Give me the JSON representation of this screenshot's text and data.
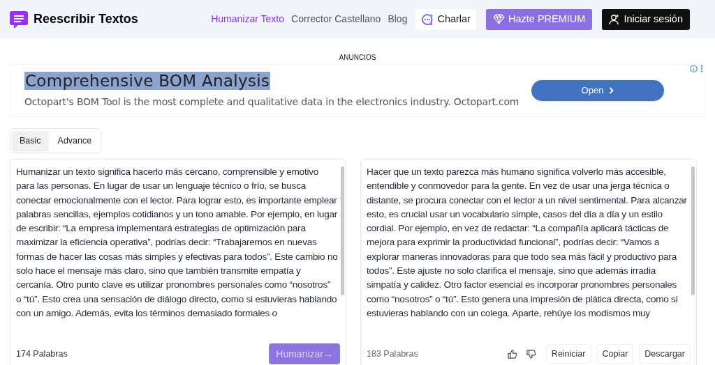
{
  "header": {
    "brand": "Reescribir Textos",
    "nav": [
      {
        "label": "Humanizar Texto",
        "selected": true
      },
      {
        "label": "Corrector Castellano",
        "selected": false
      },
      {
        "label": "Blog",
        "selected": false
      }
    ],
    "buttons": [
      {
        "kind": "chat",
        "label": "Charlar"
      },
      {
        "kind": "premium",
        "label": "Hazte PREMIUM"
      },
      {
        "kind": "login",
        "label": "Iniciar sesión"
      }
    ]
  },
  "ad": {
    "label": "ANUNCIOS",
    "title": "Comprehensive BOM Analysis",
    "description": "Octopart's BOM Tool is the most complete and qualitative data in the electronics industry. Octopart.com",
    "button": "Open"
  },
  "mode_tabs": [
    {
      "label": "Basic",
      "selected": true
    },
    {
      "label": "Advance",
      "selected": false
    }
  ],
  "input_panel": {
    "text": "Humanizar un texto significa hacerlo más cercano, comprensible y emotivo para las personas. En lugar de usar un lenguaje técnico o frío, se busca conectar emocionalmente con el lector. Para lograr esto, es importante emplear palabras sencillas, ejemplos cotidianos y un tono amable. Por ejemplo, en lugar de escribir: “La empresa implementará estrategias de optimización para maximizar la eficiencia operativa”, podrías decir: “Trabajaremos en nuevas formas de hacer las cosas más simples y efectivas para todos”. Este cambio no solo hace el mensaje más claro, sino que también transmite empatía y cercanía. Otro punto clave es utilizar pronombres personales como “nosotros” o “tú”. Esto crea una sensación de diálogo directo, como si estuvieras hablando con un amigo. Además, evita los términos demasiado formales o",
    "word_count": "174 Palabras",
    "button": "Humanizar→"
  },
  "output_panel": {
    "text": "Hacer que un texto parezca más humano significa volverlo más accesible, entendible y conmovedor para la gente. En vez de usar una jerga técnica o distante, se procura conectar con el lector a un nivel sentimental. Para alcanzar esto, es crucial usar un vocabulario simple, casos del día a día y un estilo cordial. Por ejemplo, en vez de redactar: “La compañía aplicará tácticas de mejora para exprimir la productividad funcional”, podrías decir: “Vamos a explorar maneras innovadoras para que todo sea más fácil y productivo para todos”. Este ajuste no solo clarifica el mensaje, sino que además irradia simpatía y calidez. Otro factor esencial es incorporar pronombres personales como “nosotros” o “tú”. Esto genera una impresión de plática directa, como si estuvieras hablando con un colega. Aparte, rehúye los modismos muy",
    "word_count": "183 Palabras",
    "actions": [
      "Reiniciar",
      "Copiar",
      "Descargar"
    ]
  }
}
